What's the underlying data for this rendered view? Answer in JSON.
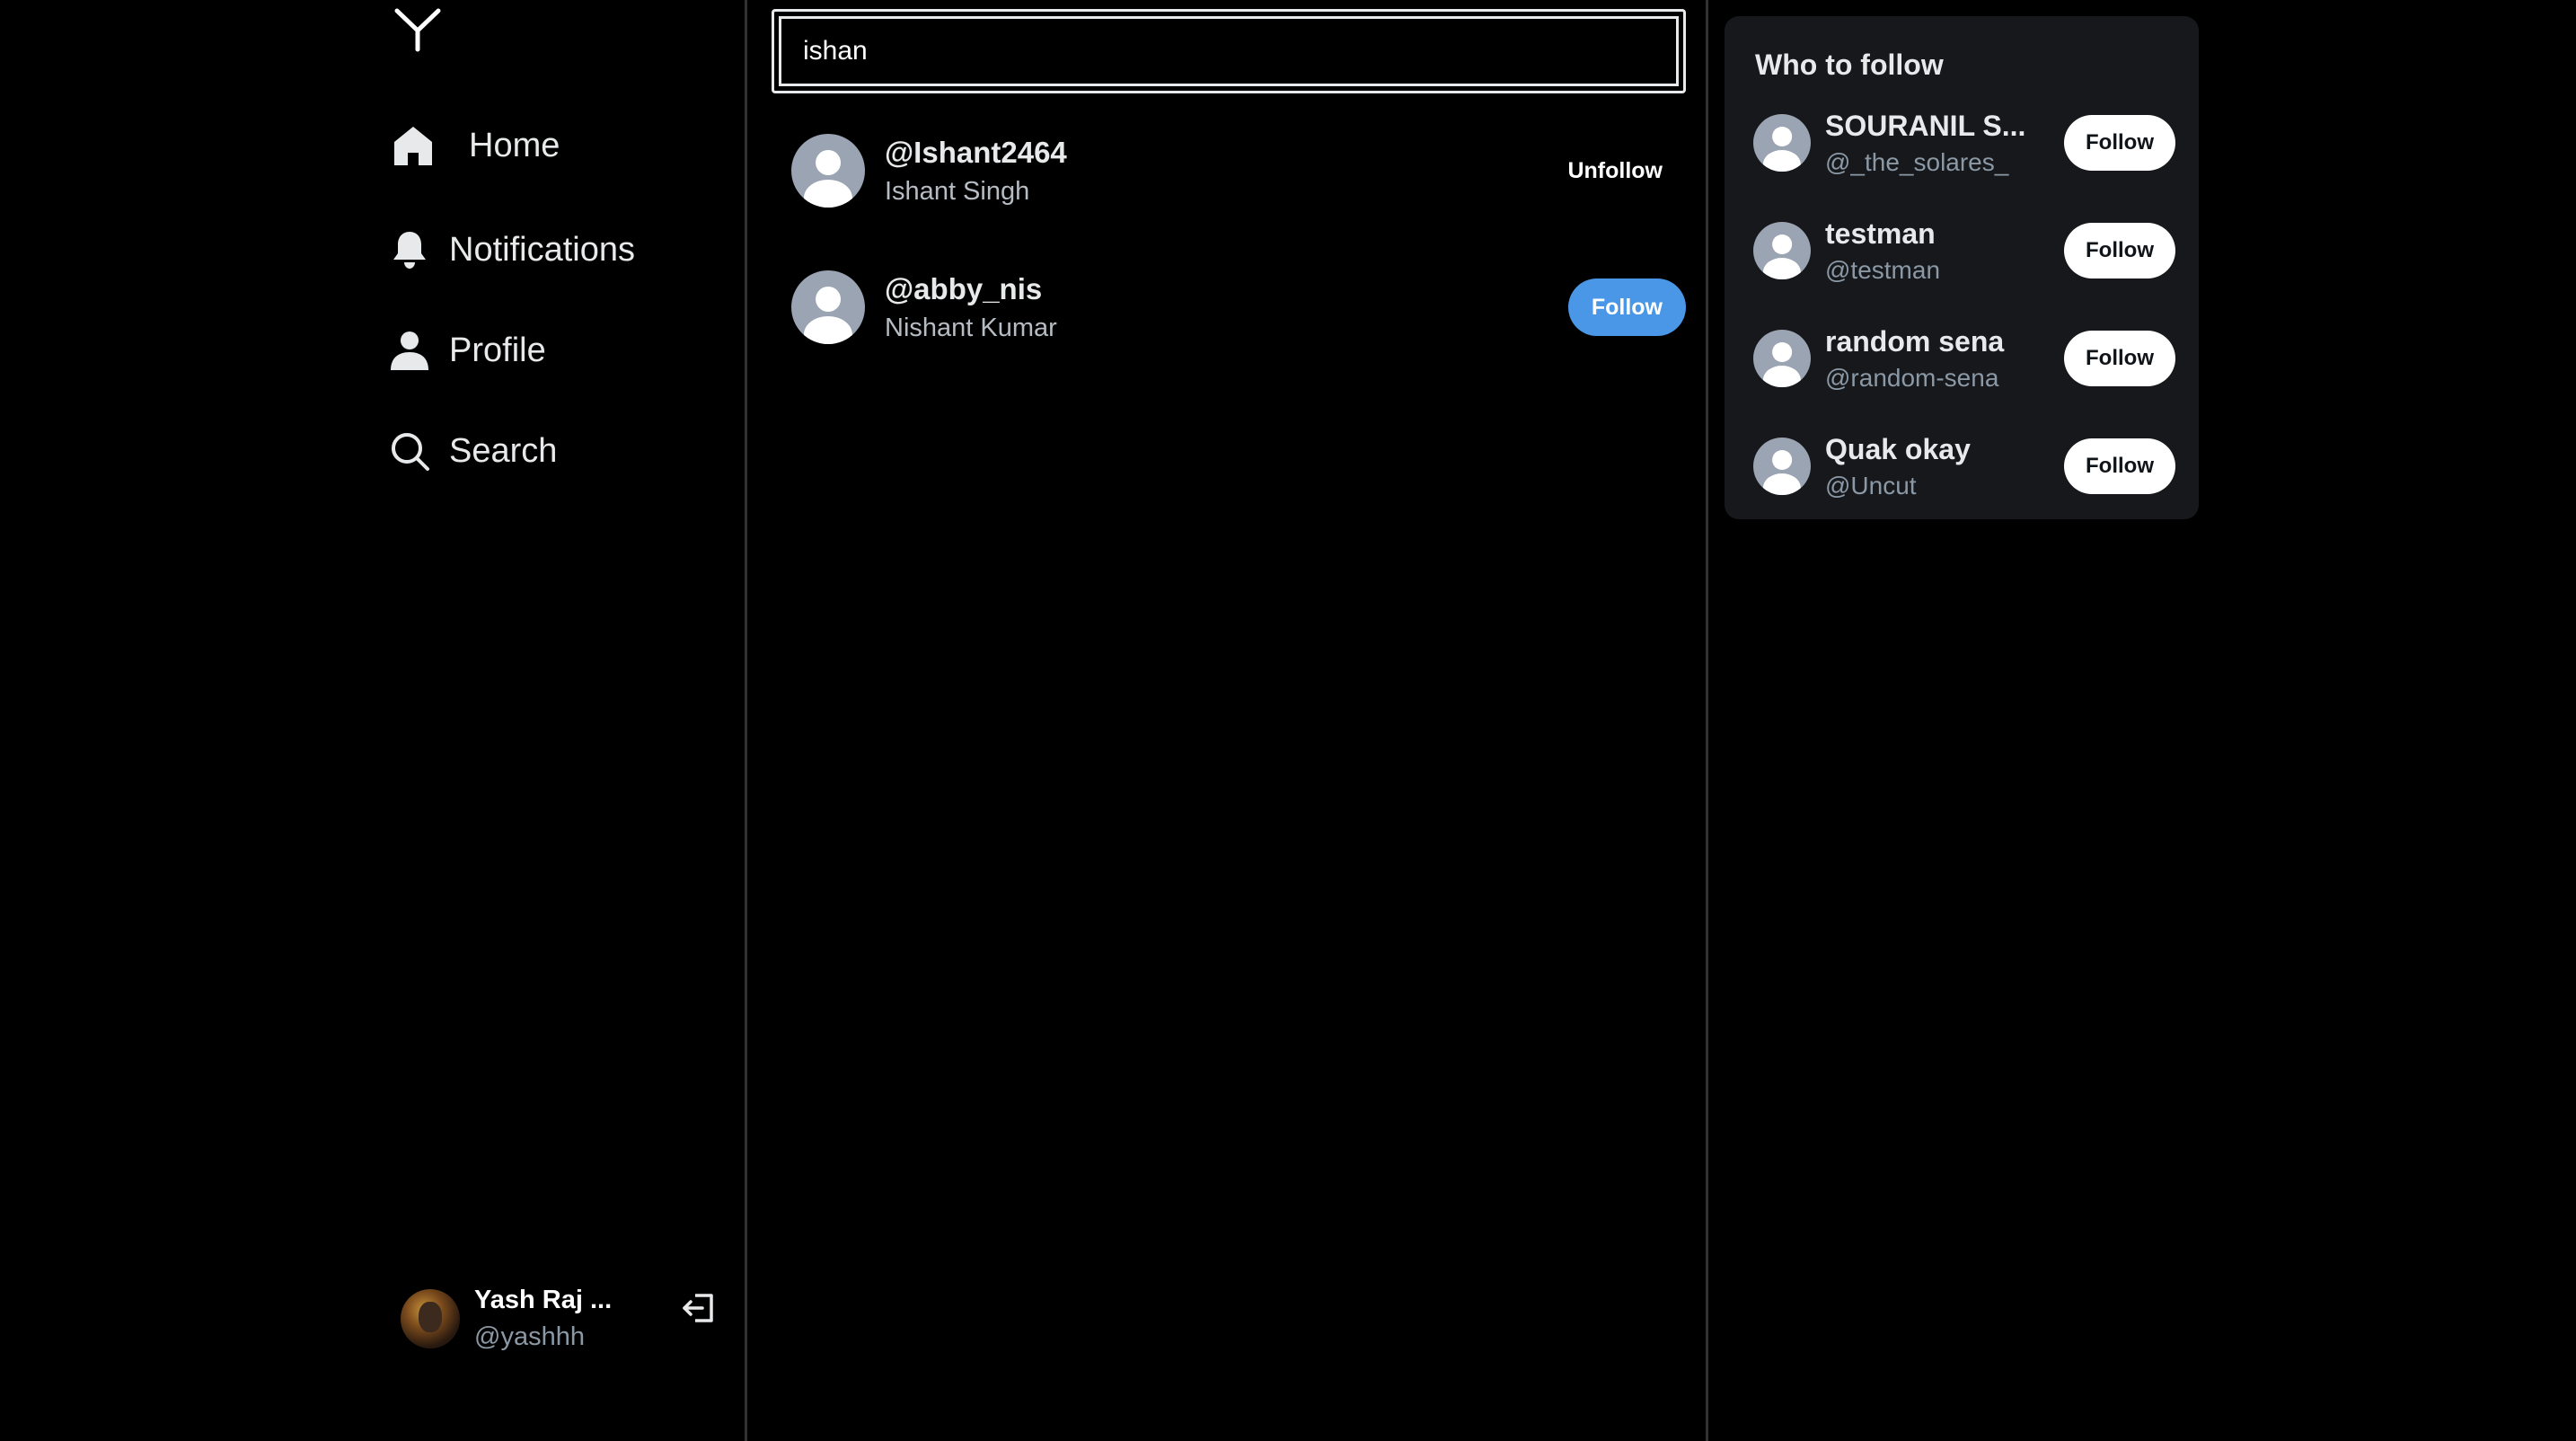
{
  "nav": {
    "items": [
      {
        "label": "Home",
        "icon": "home-icon"
      },
      {
        "label": "Notifications",
        "icon": "bell-icon"
      },
      {
        "label": "Profile",
        "icon": "person-icon"
      },
      {
        "label": "Search",
        "icon": "search-icon"
      }
    ]
  },
  "account": {
    "name": "Yash Raj ...",
    "handle": "@yashhh"
  },
  "search": {
    "value": "ishan"
  },
  "results": [
    {
      "handle": "@Ishant2464",
      "name": "Ishant Singh",
      "action": "Unfollow"
    },
    {
      "handle": "@abby_nis",
      "name": "Nishant Kumar",
      "action": "Follow"
    }
  ],
  "who_to_follow": {
    "title": "Who to follow",
    "users": [
      {
        "name": "SOURANIL S...",
        "handle": "@_the_solares_",
        "action": "Follow"
      },
      {
        "name": "testman",
        "handle": "@testman",
        "action": "Follow"
      },
      {
        "name": "random sena",
        "handle": "@random-sena",
        "action": "Follow"
      },
      {
        "name": "Quak okay",
        "handle": "@Uncut",
        "action": "Follow"
      }
    ]
  },
  "colors": {
    "background": "#000000",
    "panel": "#16181c",
    "accent_blue": "#4a97e8",
    "divider": "#2f3336"
  }
}
